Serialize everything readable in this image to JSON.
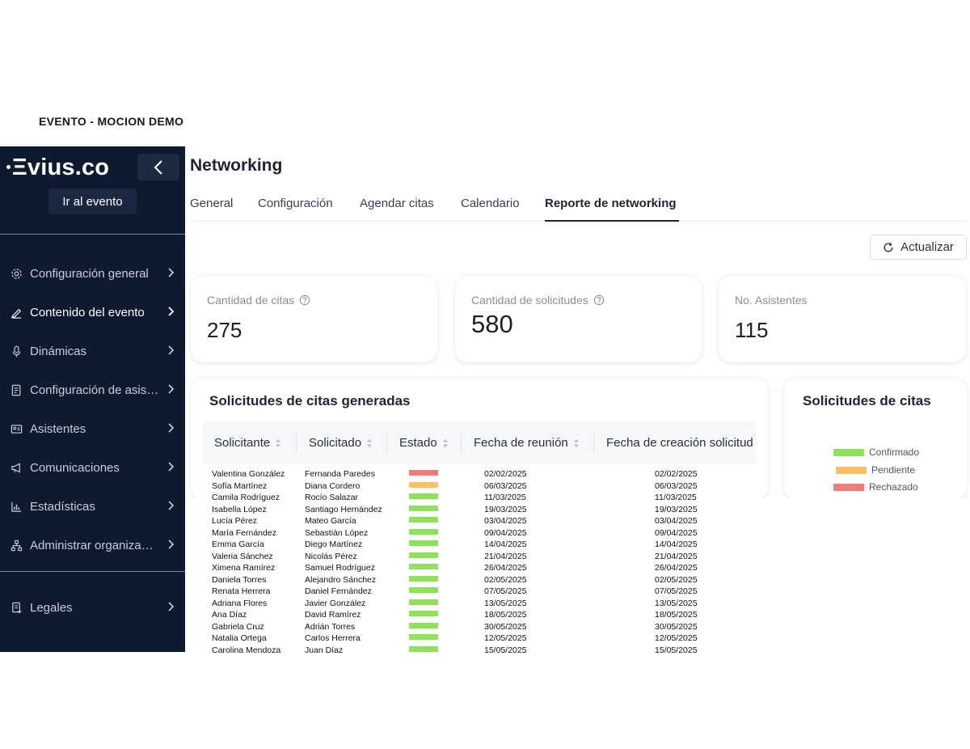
{
  "event_title": "EVENTO - MOCION DEMO",
  "sidebar": {
    "logo": "vius.co",
    "goto_event": "Ir al evento",
    "items": [
      {
        "label": "Configuración general",
        "icon": "gear-icon"
      },
      {
        "label": "Contenido del evento",
        "icon": "pencil-icon"
      },
      {
        "label": "Dinámicas",
        "icon": "microphone-icon"
      },
      {
        "label": "Configuración de asistentes",
        "icon": "form-icon"
      },
      {
        "label": "Asistentes",
        "icon": "id-card-icon"
      },
      {
        "label": "Comunicaciones",
        "icon": "megaphone-icon"
      },
      {
        "label": "Estadísticas",
        "icon": "bar-chart-icon"
      },
      {
        "label": "Administrar organización",
        "icon": "org-chart-icon"
      }
    ],
    "legal": {
      "label": "Legales",
      "icon": "document-icon"
    }
  },
  "page": {
    "title": "Networking",
    "tabs": [
      "General",
      "Configuración",
      "Agendar citas",
      "Calendario",
      "Reporte de networking"
    ],
    "active_tab": "Reporte de networking",
    "refresh_label": "Actualizar"
  },
  "stats": [
    {
      "label": "Cantidad de citas",
      "value": "275"
    },
    {
      "label": "Cantidad de solicitudes",
      "value": "580"
    },
    {
      "label": "No. Asistentes",
      "value": "115"
    }
  ],
  "table": {
    "title": "Solicitudes de citas generadas",
    "columns": [
      "Solicitante",
      "Solicitado",
      "Estado",
      "Fecha de reunión",
      "Fecha de creación solicitud"
    ],
    "rows": [
      {
        "solicitante": "Valentina González",
        "solicitado": "Fernanda Paredes",
        "estado": "Rechazado",
        "fecha_reunion": "02/02/2025",
        "fecha_creacion": "02/02/2025"
      },
      {
        "solicitante": "Sofía Martínez",
        "solicitado": "Diana Cordero",
        "estado": "Pendiente",
        "fecha_reunion": "06/03/2025",
        "fecha_creacion": "06/03/2025"
      },
      {
        "solicitante": "Camila Rodríguez",
        "solicitado": "Rocío Salazar",
        "estado": "Confirmado",
        "fecha_reunion": "11/03/2025",
        "fecha_creacion": "11/03/2025"
      },
      {
        "solicitante": "Isabella López",
        "solicitado": "Santiago Hernández",
        "estado": "Confirmado",
        "fecha_reunion": "19/03/2025",
        "fecha_creacion": "19/03/2025"
      },
      {
        "solicitante": "Lucía Pérez",
        "solicitado": "Mateo García",
        "estado": "Confirmado",
        "fecha_reunion": "03/04/2025",
        "fecha_creacion": "03/04/2025"
      },
      {
        "solicitante": "María Fernández",
        "solicitado": "Sebastián López",
        "estado": "Confirmado",
        "fecha_reunion": "09/04/2025",
        "fecha_creacion": "09/04/2025"
      },
      {
        "solicitante": "Emma García",
        "solicitado": "Diego Martínez",
        "estado": "Confirmado",
        "fecha_reunion": "14/04/2025",
        "fecha_creacion": "14/04/2025"
      },
      {
        "solicitante": "Valeria Sánchez",
        "solicitado": "Nicolás Pérez",
        "estado": "Confirmado",
        "fecha_reunion": "21/04/2025",
        "fecha_creacion": "21/04/2025"
      },
      {
        "solicitante": "Ximena Ramírez",
        "solicitado": "Samuel Rodríguez",
        "estado": "Confirmado",
        "fecha_reunion": "26/04/2025",
        "fecha_creacion": "26/04/2025"
      },
      {
        "solicitante": "Daniela Torres",
        "solicitado": "Alejandro Sánchez",
        "estado": "Confirmado",
        "fecha_reunion": "02/05/2025",
        "fecha_creacion": "02/05/2025"
      },
      {
        "solicitante": "Renata Herrera",
        "solicitado": "Daniel Fernández",
        "estado": "Confirmado",
        "fecha_reunion": "07/05/2025",
        "fecha_creacion": "07/05/2025"
      },
      {
        "solicitante": "Adriana Flores",
        "solicitado": "Javier González",
        "estado": "Confirmado",
        "fecha_reunion": "13/05/2025",
        "fecha_creacion": "13/05/2025"
      },
      {
        "solicitante": "Ana Díaz",
        "solicitado": "David Ramírez",
        "estado": "Confirmado",
        "fecha_reunion": "18/05/2025",
        "fecha_creacion": "18/05/2025"
      },
      {
        "solicitante": "Gabriela Cruz",
        "solicitado": "Adrián Torres",
        "estado": "Confirmado",
        "fecha_reunion": "30/05/2025",
        "fecha_creacion": "30/05/2025"
      },
      {
        "solicitante": "Natalia Ortega",
        "solicitado": "Carlos Herrera",
        "estado": "Confirmado",
        "fecha_reunion": "12/05/2025",
        "fecha_creacion": "12/05/2025"
      },
      {
        "solicitante": "Carolina Mendoza",
        "solicitado": "Juan Díaz",
        "estado": "Confirmado",
        "fecha_reunion": "15/05/2025",
        "fecha_creacion": "15/05/2025"
      }
    ]
  },
  "status_colors": {
    "Confirmado": "#8fe05b",
    "Pendiente": "#ffbf66",
    "Rechazado": "#f57b78"
  },
  "chart_panel": {
    "title": "Solicitudes de citas",
    "legend": [
      "Confirmado",
      "Pendiente",
      "Rechazado"
    ]
  },
  "colors": {
    "sidebar_bg": "#0e1a2e",
    "accent": "#1f2433"
  }
}
